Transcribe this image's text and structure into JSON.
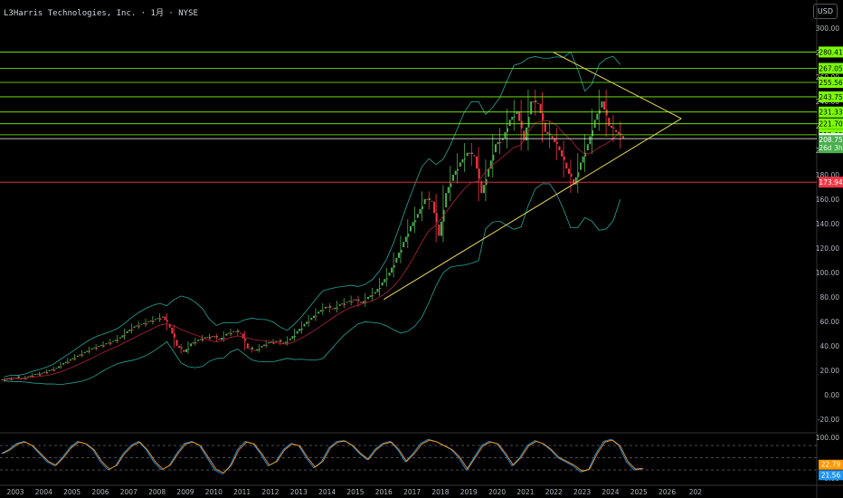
{
  "header": {
    "title": "L3Harris Technologies, Inc. · 1月 · NYSE",
    "currency": "USD"
  },
  "chart_data": {
    "type": "candlestick",
    "price_axis": {
      "ticks": [
        300,
        280,
        260,
        240,
        220,
        200,
        180,
        160,
        140,
        120,
        100,
        80,
        60,
        40,
        20,
        0,
        -20
      ],
      "range": [
        -30,
        305
      ]
    },
    "time_axis": {
      "ticks": [
        "2003",
        "2004",
        "2005",
        "2006",
        "2007",
        "2008",
        "2009",
        "2010",
        "2011",
        "2012",
        "2013",
        "2014",
        "2015",
        "2016",
        "2017",
        "2018",
        "2019",
        "2020",
        "2021",
        "2022",
        "2023",
        "2024",
        "2025",
        "2026",
        "202"
      ]
    },
    "start": 2002.5,
    "quarterly_closes": [
      13,
      14,
      13,
      15,
      17,
      18,
      20,
      22,
      26,
      29,
      32,
      35,
      38,
      40,
      42,
      44,
      47,
      52,
      56,
      58,
      60,
      62,
      64,
      55,
      40,
      35,
      42,
      45,
      47,
      48,
      45,
      50,
      52,
      50,
      38,
      36,
      40,
      43,
      44,
      42,
      46,
      52,
      58,
      63,
      68,
      72,
      70,
      74,
      76,
      78,
      75,
      80,
      84,
      92,
      100,
      112,
      125,
      138,
      148,
      160,
      158,
      130,
      165,
      180,
      190,
      198,
      195,
      165,
      185,
      205,
      210,
      225,
      232,
      208,
      240,
      238,
      215,
      210,
      200,
      185,
      172,
      190,
      205,
      225,
      240,
      220,
      215,
      210
    ],
    "horizontal_levels": [
      {
        "value": 280.41,
        "label": "280.41",
        "color": "#7cfc00"
      },
      {
        "value": 267.05,
        "label": "267.05",
        "color": "#7cfc00"
      },
      {
        "value": 255.56,
        "label": "255.56",
        "color": "#7cfc00"
      },
      {
        "value": 243.75,
        "label": "243.75",
        "color": "#7cfc00"
      },
      {
        "value": 231.33,
        "label": "231.33",
        "color": "#7cfc00"
      },
      {
        "value": 221.7,
        "label": "221.70",
        "color": "#7cfc00"
      },
      {
        "value": 212.69,
        "label": "212.69",
        "color": "#7cfc00"
      },
      {
        "value": 209.53,
        "label": "209.53",
        "color": "#ffffff"
      },
      {
        "value": 173.94,
        "label": "173.94",
        "color": "#f23645"
      }
    ],
    "last_price": {
      "value": 208.75,
      "label": "208.75",
      "countdown": "26d 3h",
      "color": "#4caf50"
    },
    "triangle": {
      "upper": [
        [
          2022.0,
          280
        ],
        [
          2026.5,
          226
        ]
      ],
      "lower": [
        [
          2016.0,
          78
        ],
        [
          2026.5,
          226
        ]
      ],
      "color": "#e6d45a"
    },
    "stochastic": {
      "ticks": [
        100,
        0
      ],
      "bands": [
        80,
        50,
        20
      ],
      "k_label": "22.79",
      "d_label": "21.56",
      "k_color": "#ff9800",
      "d_color": "#2196f3",
      "k": [
        60,
        70,
        85,
        90,
        80,
        60,
        40,
        30,
        50,
        75,
        90,
        85,
        70,
        40,
        20,
        30,
        60,
        80,
        90,
        70,
        40,
        20,
        30,
        60,
        85,
        90,
        80,
        50,
        20,
        10,
        30,
        70,
        90,
        85,
        60,
        30,
        40,
        70,
        85,
        80,
        50,
        25,
        40,
        75,
        90,
        92,
        80,
        60,
        45,
        70,
        85,
        90,
        70,
        40,
        60,
        85,
        95,
        90,
        80,
        70,
        50,
        20,
        50,
        80,
        90,
        85,
        60,
        30,
        50,
        80,
        92,
        85,
        70,
        50,
        40,
        30,
        15,
        20,
        60,
        90,
        95,
        80,
        40,
        20,
        22
      ]
    }
  }
}
